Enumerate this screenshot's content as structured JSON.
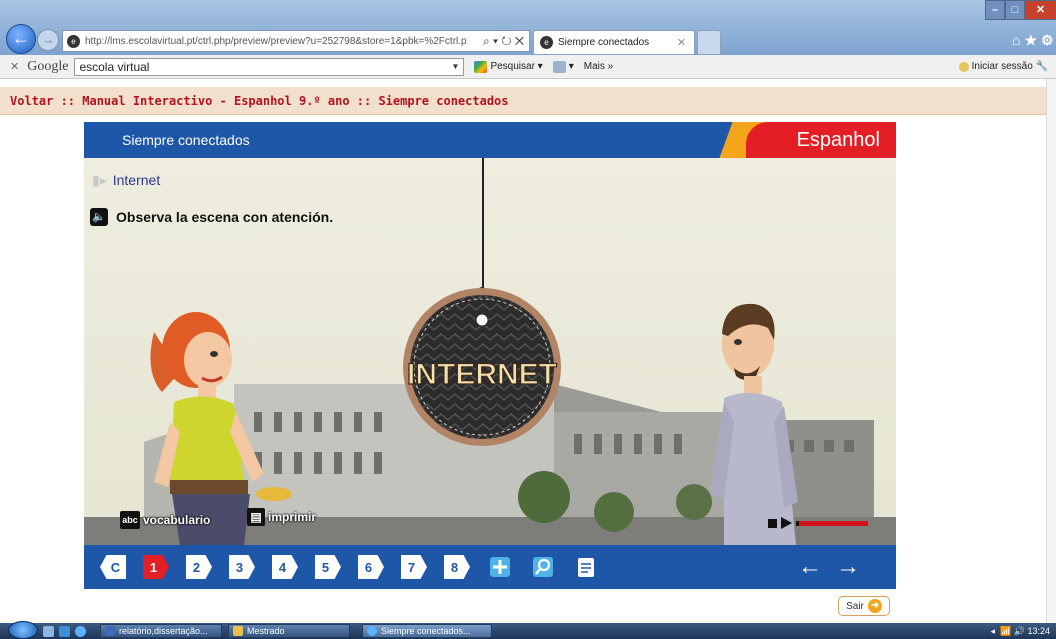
{
  "browser": {
    "url": "http://lms.escolavirtual.pt/ctrl.php/preview/preview?u=252798&store=1&pbk=%2Fctrl.p",
    "tab_title": "Siempre conectados",
    "nav_controls": "⌕ ▾ ↻ ✕"
  },
  "google_toolbar": {
    "logo": "Google",
    "search_value": "escola virtual",
    "pesquisar_label": "Pesquisar",
    "mais_label": "Mais »",
    "signin_label": "Iniciar sessão"
  },
  "breadcrumb": "Voltar :: Manual Interactivo - Espanhol 9.º ano :: Siempre conectados",
  "lesson": {
    "header_title": "Siempre conectados",
    "subject": "Espanhol",
    "topic": "Internet",
    "instruction": "Observa la escena con atención.",
    "sign_text": "INTERNET",
    "vocab_label": "vocabulario",
    "vocab_icon_text": "abc",
    "print_label": "imprimir"
  },
  "nav": {
    "start_label": "C",
    "pages": [
      "1",
      "2",
      "3",
      "4",
      "5",
      "6",
      "7",
      "8"
    ],
    "active_page": "1",
    "prev_icon": "←",
    "next_icon": "→"
  },
  "exit_label": "Sair",
  "taskbar": {
    "items": [
      "relatório,dissertação...",
      "Mestrado",
      "Siempre conectados..."
    ],
    "clock": "13:24"
  },
  "colors": {
    "brand_blue": "#1f57a8",
    "brand_red": "#e31e24",
    "brand_orange": "#f4a51c",
    "breadcrumb_text": "#b3121f"
  },
  "icons": [
    "back-icon",
    "forward-icon",
    "speaker-icon",
    "abc-icon",
    "printer-icon",
    "expand-icon",
    "magnifier-icon",
    "clipboard-icon",
    "stop-icon",
    "play-icon",
    "exit-icon",
    "home-icon",
    "star-icon",
    "gear-icon"
  ]
}
